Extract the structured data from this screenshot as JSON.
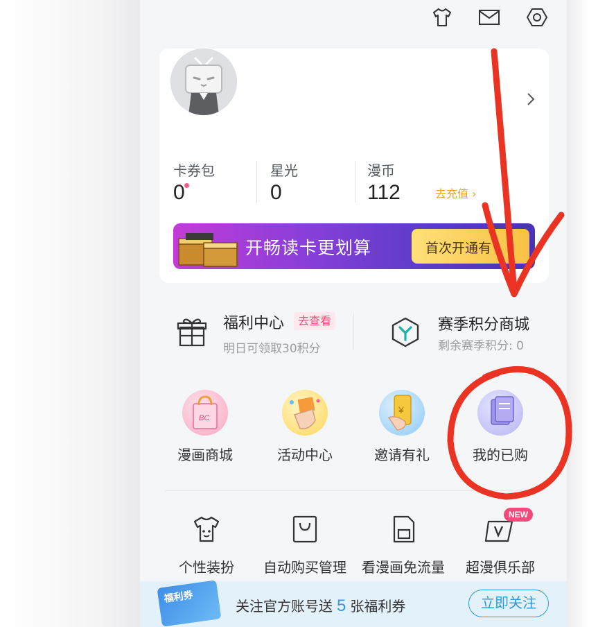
{
  "header": {
    "icons": [
      "tshirt-icon",
      "mail-icon",
      "settings-icon"
    ]
  },
  "profile": {
    "stats": [
      {
        "label": "卡券包",
        "value": "0"
      },
      {
        "label": "星光",
        "value": "0"
      },
      {
        "label": "漫币",
        "value": "112"
      }
    ],
    "recharge_label": "去充值",
    "banner": {
      "text": "开畅读卡更划算",
      "button": "首次开通有"
    }
  },
  "welfare": {
    "left": {
      "title": "福利中心",
      "tag": "去查看",
      "subtitle": "明日可领取30积分"
    },
    "right": {
      "title": "赛季积分商城",
      "subtitle": "剩余赛季积分: 0"
    }
  },
  "features": [
    {
      "label": "漫画商城",
      "icon": "bag-icon"
    },
    {
      "label": "活动中心",
      "icon": "hand-icon"
    },
    {
      "label": "邀请有礼",
      "icon": "phone-icon"
    },
    {
      "label": "我的已购",
      "icon": "books-icon"
    }
  ],
  "tools": [
    {
      "label": "个性装扮",
      "icon": "tshirt-icon"
    },
    {
      "label": "自动购买管理",
      "icon": "shopping-bag-icon"
    },
    {
      "label": "看漫画免流量",
      "icon": "sim-card-icon"
    },
    {
      "label": "超漫俱乐部",
      "icon": "club-icon",
      "badge": "NEW"
    }
  ],
  "bottom_bar": {
    "coupon_label": "福利券",
    "text_before": "关注官方账号送",
    "count": "5",
    "text_after": "张福利券",
    "button": "立即关注"
  },
  "colors": {
    "annotation_red": "#ea3323",
    "accent_blue": "#2e9ae0",
    "accent_pink": "#f25d8e",
    "accent_orange": "#e8a417"
  }
}
